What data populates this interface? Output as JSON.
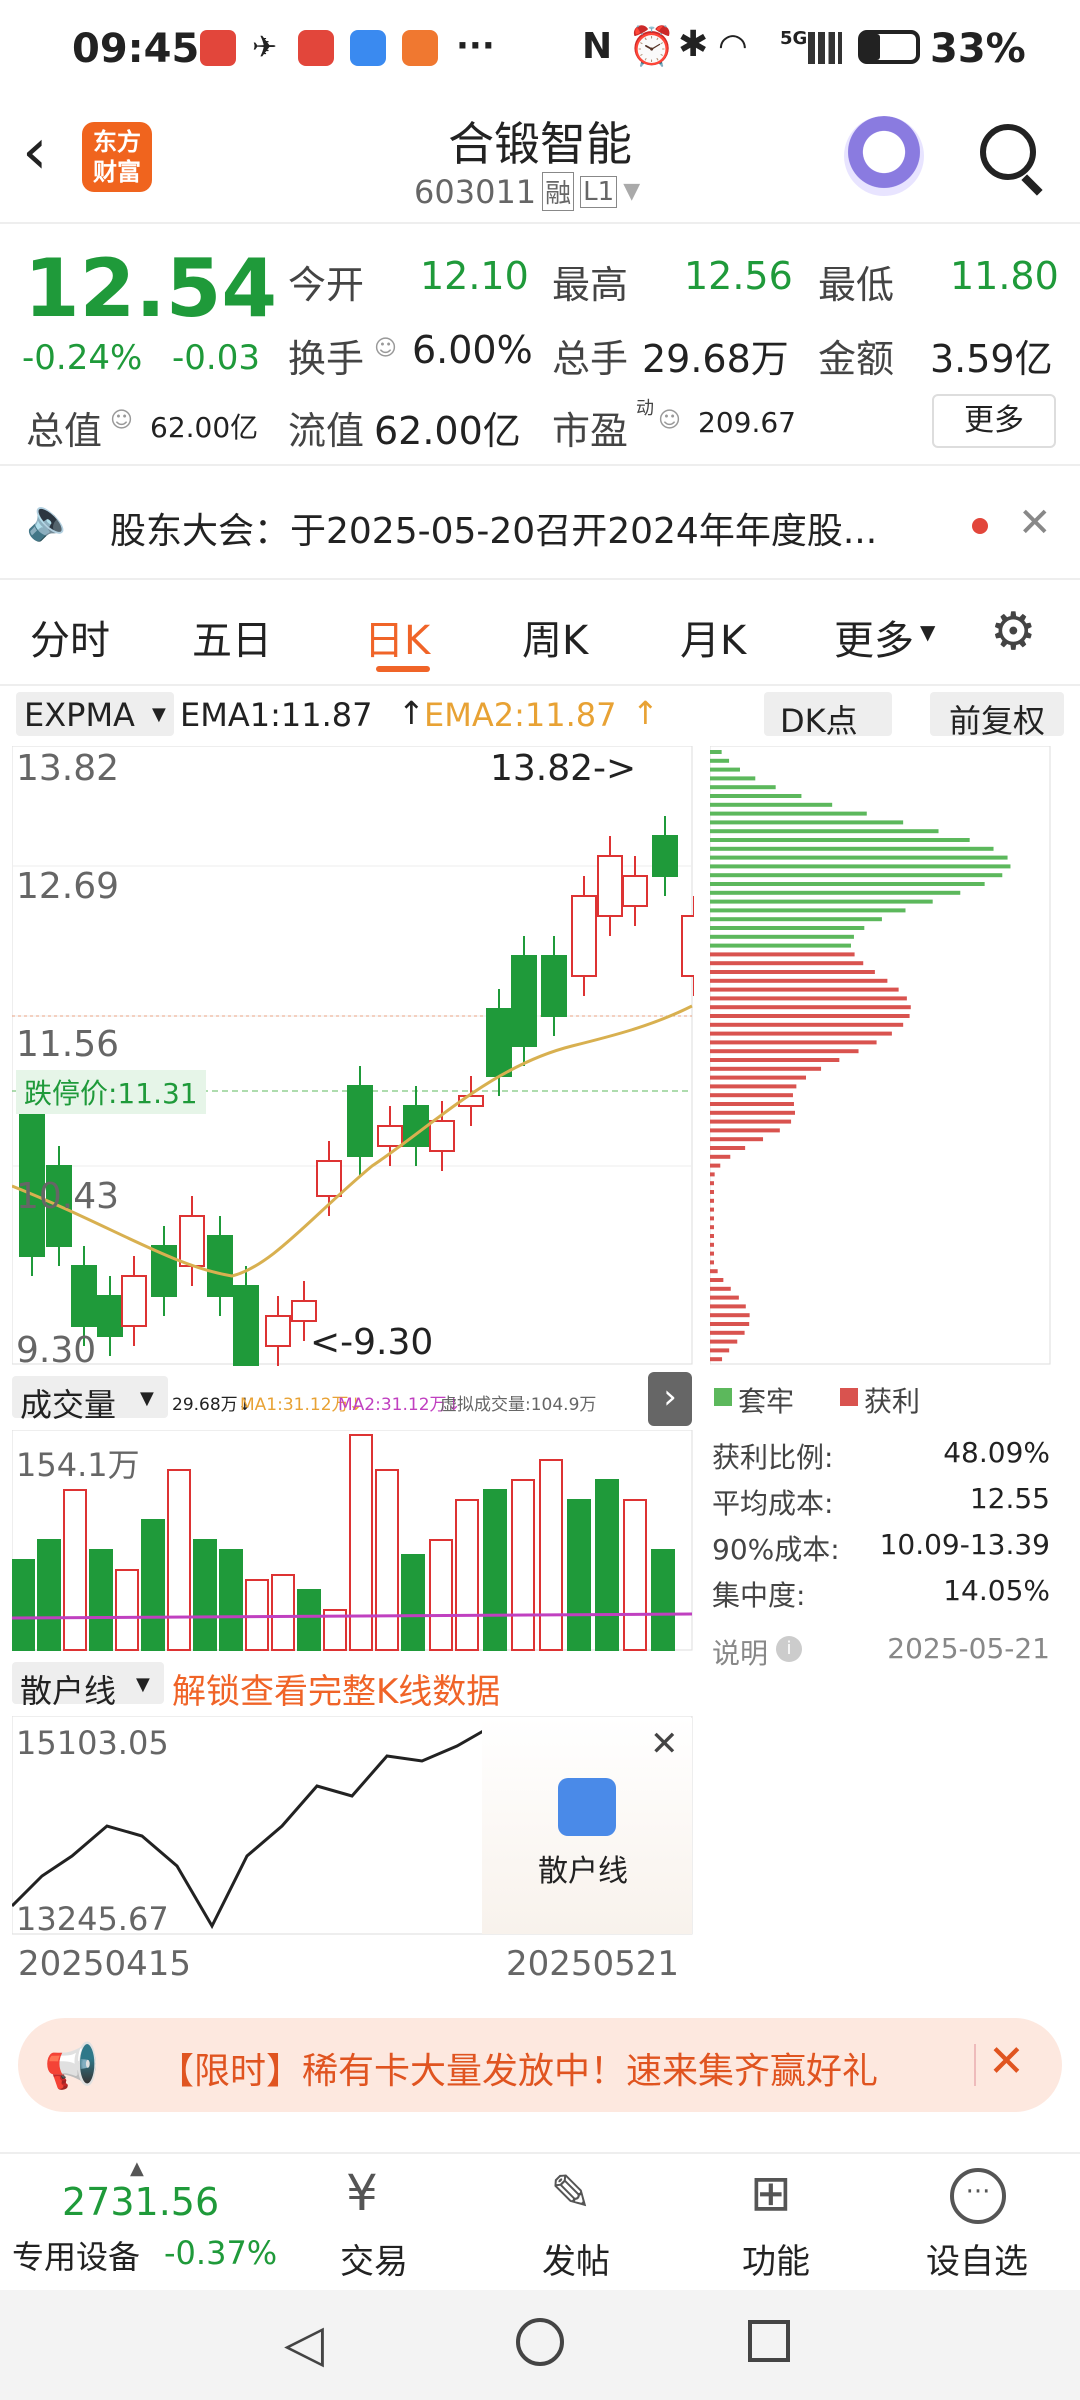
{
  "status": {
    "time": "09:45",
    "battery": "33%",
    "net": "5G"
  },
  "header": {
    "title": "合锻智能",
    "code": "603011",
    "rong": "融",
    "level": "L1",
    "logo": "东方财富"
  },
  "quote": {
    "price": "12.54",
    "pct": "-0.24%",
    "chg": "-0.03",
    "row1": [
      {
        "l": "今开",
        "v": "12.10"
      },
      {
        "l": "最高",
        "v": "12.56"
      },
      {
        "l": "最低",
        "v": "11.80"
      }
    ],
    "row2": [
      {
        "l": "换手",
        "v": "6.00%"
      },
      {
        "l": "总手",
        "v": "29.68万"
      },
      {
        "l": "金额",
        "v": "3.59亿"
      }
    ],
    "zongzhi_l": "总值",
    "zongzhi_v": "62.00亿",
    "liuzhi_l": "流值",
    "liuzhi_v": "62.00亿",
    "shiying_l": "市盈",
    "shiying_sup": "动",
    "shiying_v": "209.67",
    "more": "更多"
  },
  "notice": {
    "text": "股东大会：于2025-05-20召开2024年年度股..."
  },
  "tabs": [
    "分时",
    "五日",
    "日K",
    "周K",
    "月K",
    "更多"
  ],
  "indicator": {
    "name": "EXPMA",
    "ema1": "EMA1:11.87",
    "ema2": "EMA2:11.87",
    "dk": "DK点",
    "fq": "前复权"
  },
  "kline": {
    "y_labels": [
      "13.82",
      "12.69",
      "11.56",
      "10.43",
      "9.30"
    ],
    "max_label": "13.82->",
    "min_label": "<-9.30",
    "limit_down": "跌停价:11.31"
  },
  "volume": {
    "name": "成交量",
    "legend": "29.68万↓",
    "ma1": "MA1:31.12万↓",
    "ma2": "MA2:31.12万↓",
    "virtual": "虚拟成交量:104.9万",
    "ymax": "154.1万"
  },
  "retail": {
    "name": "散户线",
    "unlock": "解锁查看完整K线数据",
    "y_top": "15103.05",
    "y_bot": "13245.67",
    "x_start": "20250415",
    "x_end": "20250521",
    "badge": "散户线"
  },
  "chip": {
    "legend_trap": "套牢",
    "legend_profit": "获利",
    "rows": [
      {
        "l": "获利比例:",
        "v": "48.09%"
      },
      {
        "l": "平均成本:",
        "v": "12.55"
      },
      {
        "l": "90%成本:",
        "v": "10.09-13.39"
      },
      {
        "l": "集中度:",
        "v": "14.05%"
      }
    ],
    "note": "说明",
    "date": "2025-05-21"
  },
  "promo": {
    "text": "【限时】稀有卡大量发放中！速来集齐赢好礼"
  },
  "bottom": {
    "index_val": "2731.56",
    "index_name": "专用设备",
    "index_pct": "-0.37%",
    "items": [
      "交易",
      "发帖",
      "功能",
      "设自选"
    ]
  }
}
